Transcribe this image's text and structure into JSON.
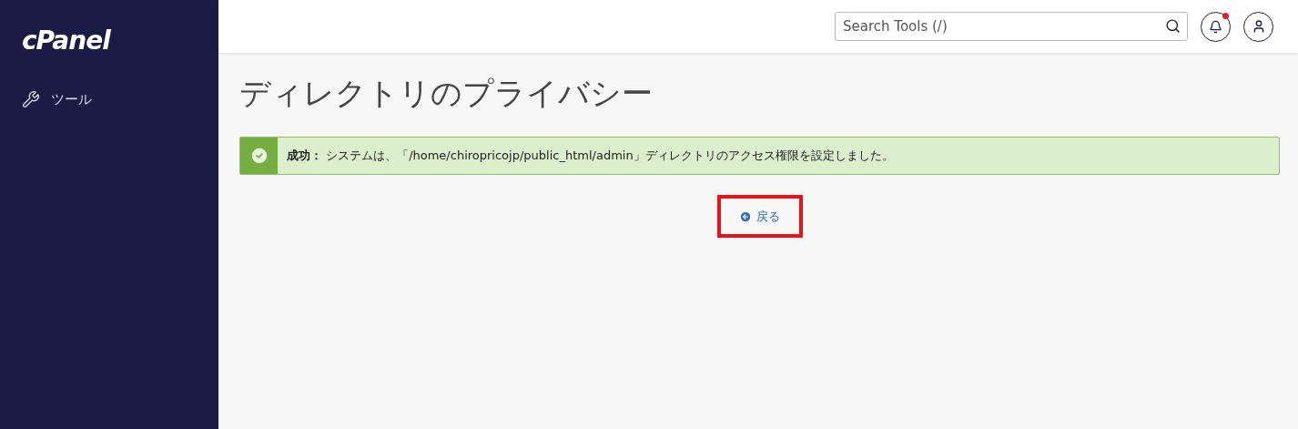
{
  "sidebar": {
    "logo": "cPanel",
    "items": [
      {
        "label": "ツール",
        "selected": false
      }
    ]
  },
  "header": {
    "search": {
      "placeholder": "Search Tools (/)"
    },
    "notifications": {
      "unread": true
    }
  },
  "page": {
    "title": "ディレクトリのプライバシー",
    "alert": {
      "kind": "success",
      "lead": "成功：",
      "message": "システムは、「/home/chiropricojp/public_html/admin」ディレクトリのアクセス権限を設定しました。"
    },
    "back_link": {
      "label": "戻る",
      "highlighted": true
    }
  }
}
